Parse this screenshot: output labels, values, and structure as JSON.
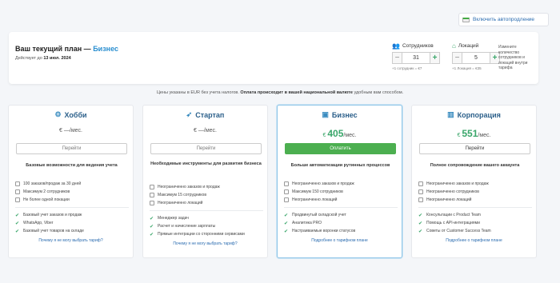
{
  "autorenew": {
    "label": "Включить автопродление"
  },
  "current_plan": {
    "title_prefix": "Ваш текущий план —",
    "plan_name": "Бизнес",
    "valid_prefix": "Действует до",
    "valid_date": "13 июл. 2024",
    "employees": {
      "label": "Сотрудников",
      "value": "31",
      "hint": "+1 сотрудник = €7"
    },
    "locations": {
      "label": "Локаций",
      "value": "5",
      "hint": "+1 Локация = €35"
    },
    "side_note": "Измените количество сотрудников и локаций внутри тарифа"
  },
  "price_note": {
    "pre": "Цены указаны в EUR без учета налогов.",
    "bold": "Оплата происходит в вашей национальной валюте",
    "post": "удобным вам способом."
  },
  "plans": [
    {
      "name": "Хобби",
      "icon": "bicycle-icon",
      "currency": "€",
      "price": "—",
      "per": "/мес.",
      "action": "Перейти",
      "desc": "Базовые возможности для ведения учета",
      "limits": [
        "100 заказов/продаж за 30 дней",
        "Максимум 2 сотрудников",
        "Не более одной локации"
      ],
      "features": [
        "Базовый учет заказов и продаж",
        "WhatsApp, Viber",
        "Базовый учет товаров на складе"
      ],
      "more": "Почему я не могу выбрать тариф?"
    },
    {
      "name": "Стартап",
      "icon": "rocket-icon",
      "currency": "€",
      "price": "—",
      "per": "/мес.",
      "action": "Перейти",
      "desc": "Необходимые инструменты для развития бизнеса",
      "limits": [
        "Неограниченно заказов и продаж",
        "Максимум 15 сотрудников",
        "Неограниченно локаций"
      ],
      "features": [
        "Менеджер задач",
        "Расчет и начисление зарплаты",
        "Прямые интеграции со сторонними сервисами"
      ],
      "more": "Почему я не могу выбрать тариф?"
    },
    {
      "name": "Бизнес",
      "icon": "briefcase-icon",
      "currency": "€",
      "price": "405",
      "per": "/мес.",
      "action": "Оплатить",
      "desc": "Больше автоматизации рутинных процессов",
      "limits": [
        "Неограниченно заказов и продаж",
        "Максимум 150 сотрудников",
        "Неограниченно локаций"
      ],
      "features": [
        "Продвинутый складской учет",
        "Аналитика PRO",
        "Настраиваемые воронки статусов"
      ],
      "more": "Подробнее о тарифном плане"
    },
    {
      "name": "Корпорация",
      "icon": "building-icon",
      "currency": "€",
      "price": "551",
      "per": "/мес.",
      "action": "Перейти",
      "desc": "Полное сопровождение вашего аккаунта",
      "limits": [
        "Неограниченно заказов и продаж",
        "Неограниченно сотрудников",
        "Неограниченно локаций"
      ],
      "features": [
        "Консультации с Product Team",
        "Помощь с API-интеграциями",
        "Советы от Customer Success Team"
      ],
      "more": "Подробнее о тарифном плане"
    }
  ]
}
